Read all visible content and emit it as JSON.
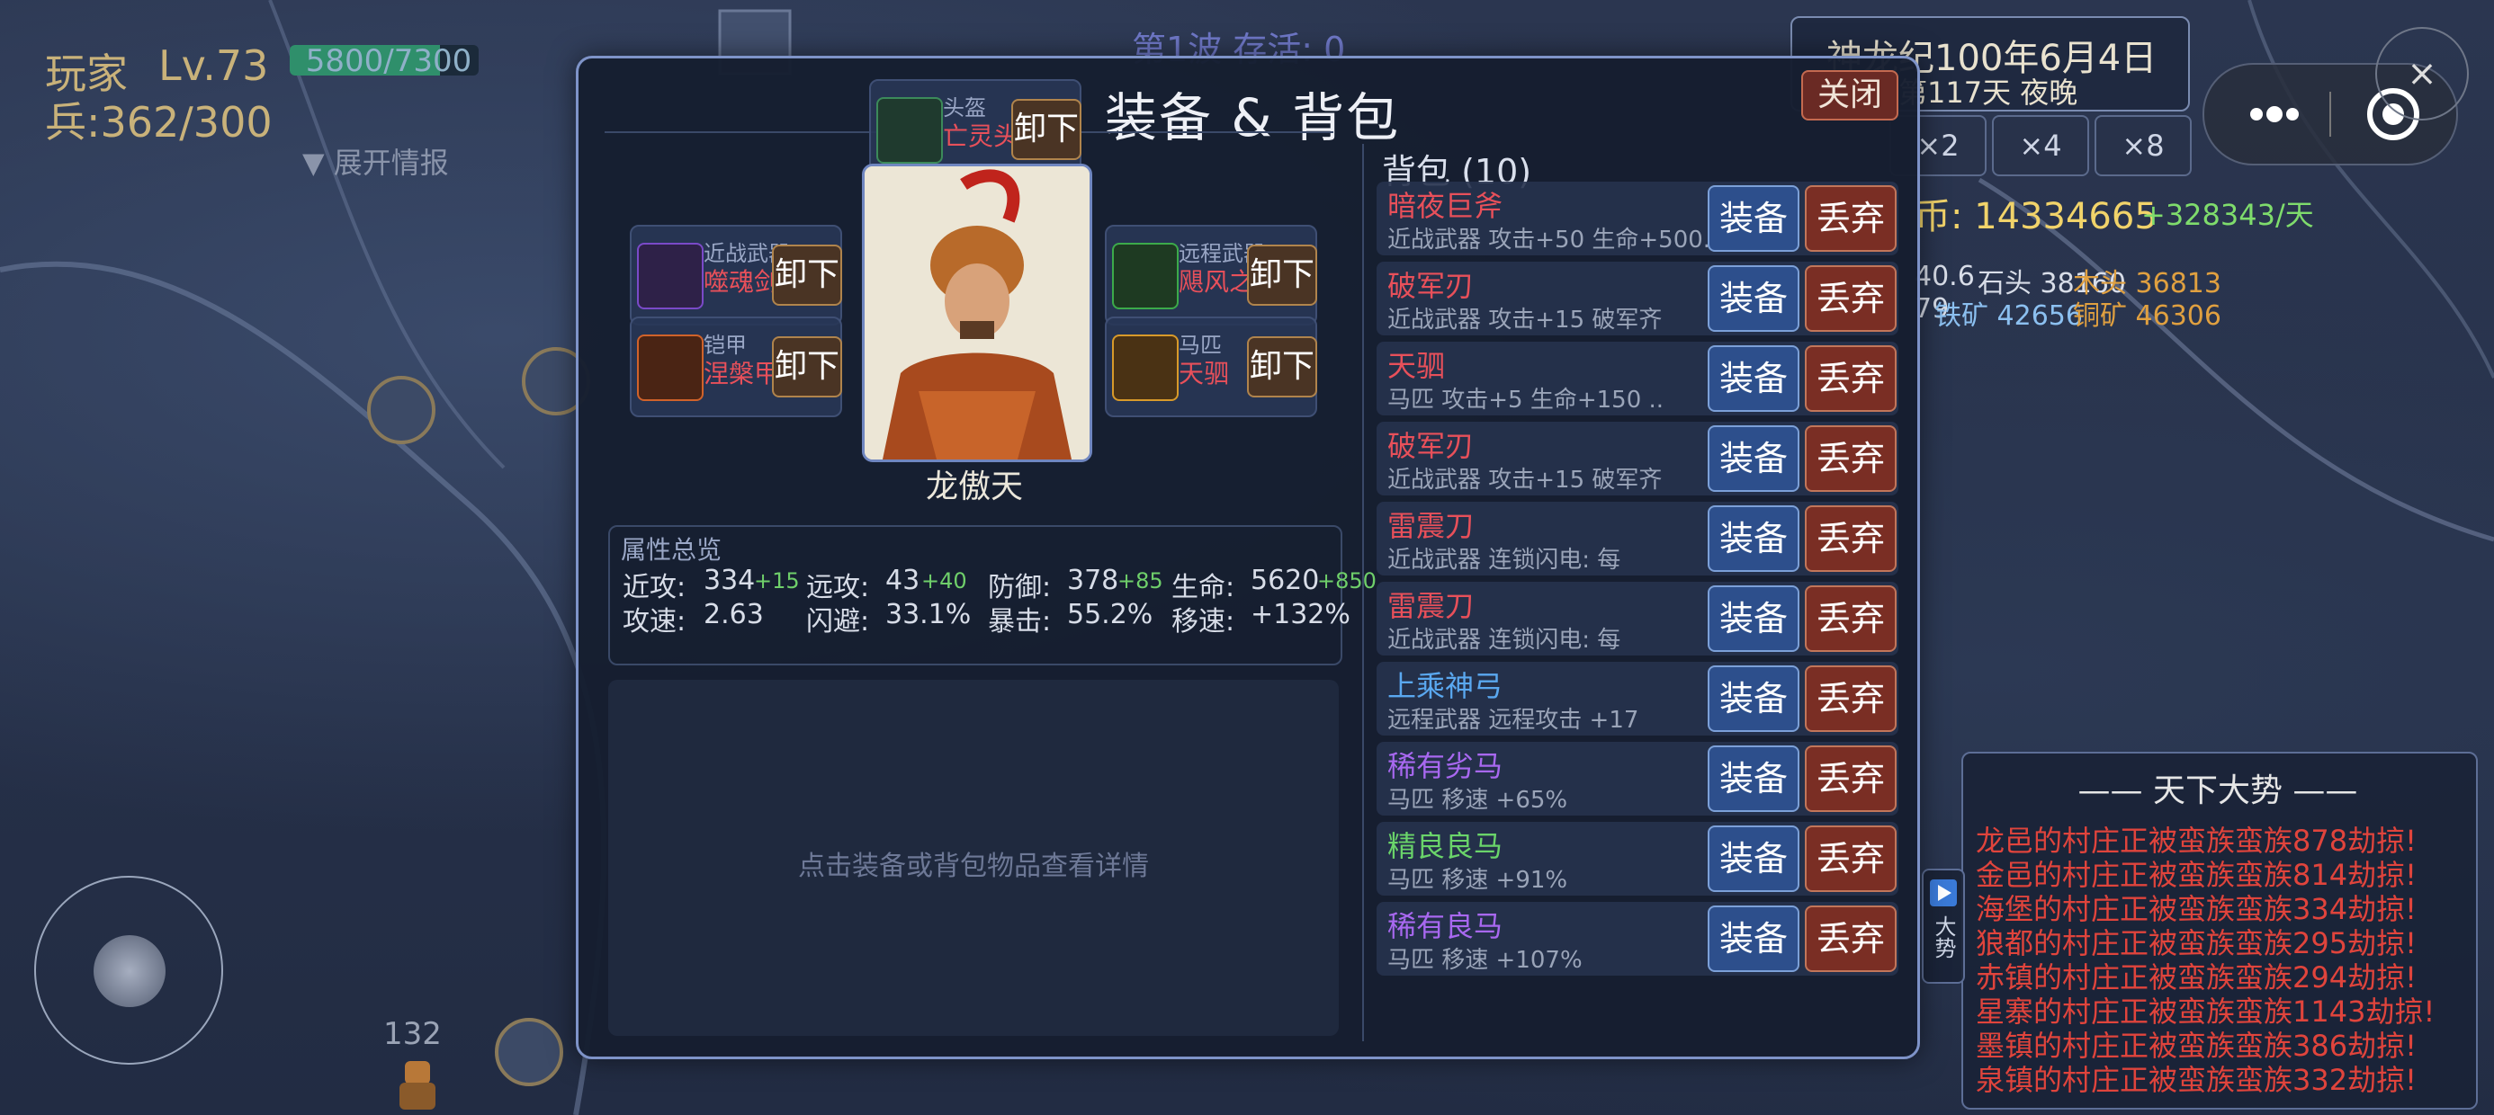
{
  "hud": {
    "player_name": "玩家",
    "level": "Lv.73",
    "xp_text": "5800/7300",
    "xp_fraction": 0.7945,
    "soldiers": "兵:362/300",
    "expand_intel": "▼ 展开情报",
    "wave": "第1波  存活: 0",
    "unit_count": "132"
  },
  "calendar": {
    "line1": "神龙纪100年6月4日",
    "line2": "第117天  夜晚"
  },
  "speed_buttons": [
    "×2",
    "×4",
    "×8"
  ],
  "economy": {
    "coins": "币: 14334665",
    "coins_rate": "+328343/天",
    "resources": [
      {
        "text": "40.6",
        "color": "#d8dde8"
      },
      {
        "text": "石头 38160",
        "color": "#d8dde8"
      },
      {
        "text": "木头 36813",
        "color": "#e0a040"
      },
      {
        "text": "79",
        "color": "#d8dde8"
      },
      {
        "text": "铁矿 42656",
        "color": "#8cc0f0"
      },
      {
        "text": "铜矿 46306",
        "color": "#e0a040"
      }
    ]
  },
  "system": {
    "more_icon": "more-dots-icon",
    "target_icon": "target-icon",
    "close_icon": "close-icon",
    "close_glyph": "×"
  },
  "modal": {
    "title": "装备 & 背包",
    "close_label": "关闭",
    "hero_name": "龙傲天",
    "detail_hint": "点击装备或背包物品查看详情",
    "slots": [
      {
        "type": "头盔",
        "item": "亡灵头",
        "button": "卸下",
        "icon_color": "#3c8a5a"
      },
      {
        "type": "近战武器",
        "item": "噬魂剑",
        "button": "卸下",
        "icon_color": "#7a4ac8"
      },
      {
        "type": "远程武器",
        "item": "飓风之弓",
        "button": "卸下",
        "icon_color": "#3caa4a"
      },
      {
        "type": "铠甲",
        "item": "涅槃甲",
        "button": "卸下",
        "icon_color": "#d0622a"
      },
      {
        "type": "马匹",
        "item": "天驷",
        "button": "卸下",
        "icon_color": "#d89a2a"
      }
    ],
    "attributes": {
      "title": "属性总览",
      "row1": [
        {
          "label": "近攻:",
          "value": "334",
          "bonus": "+15"
        },
        {
          "label": "远攻:",
          "value": "43",
          "bonus": "+40"
        },
        {
          "label": "防御:",
          "value": "378",
          "bonus": "+85"
        },
        {
          "label": "生命:",
          "value": "5620",
          "bonus": "+850"
        }
      ],
      "row2": [
        {
          "label": "攻速:",
          "value": "2.63"
        },
        {
          "label": "闪避:",
          "value": "33.1%"
        },
        {
          "label": "暴击:",
          "value": "55.2%"
        },
        {
          "label": "移速:",
          "value": "+132%"
        }
      ]
    },
    "bag": {
      "title": "背包 (10)",
      "equip_label": "装备",
      "drop_label": "丢弃",
      "items": [
        {
          "name": "暗夜巨斧",
          "desc": "近战武器 攻击+50 生命+500..",
          "color": "#e8505a"
        },
        {
          "name": "破军刃",
          "desc": "近战武器 攻击+15 破军齐",
          "color": "#e8505a"
        },
        {
          "name": "天驷",
          "desc": "马匹 攻击+5 生命+150 ..",
          "color": "#e8505a"
        },
        {
          "name": "破军刃",
          "desc": "近战武器 攻击+15 破军齐",
          "color": "#e8505a"
        },
        {
          "name": "雷震刀",
          "desc": "近战武器 连锁闪电: 每",
          "color": "#e8505a"
        },
        {
          "name": "雷震刀",
          "desc": "近战武器 连锁闪电: 每",
          "color": "#e8505a"
        },
        {
          "name": "上乘神弓",
          "desc": "远程武器 远程攻击 +17",
          "color": "#5aa8f0"
        },
        {
          "name": "稀有劣马",
          "desc": "马匹 移速 +65%",
          "color": "#a868f0"
        },
        {
          "name": "精良良马",
          "desc": "马匹 移速 +91%",
          "color": "#6ad46a"
        },
        {
          "name": "稀有良马",
          "desc": "马匹 移速 +107%",
          "color": "#a868f0"
        }
      ]
    }
  },
  "news": {
    "title": "—— 天下大势 ——",
    "tab_label": "大势",
    "tab_icon": "play-icon",
    "lines": [
      "龙邑的村庄正被蛮族蛮族878劫掠!",
      "金邑的村庄正被蛮族蛮族814劫掠!",
      "海堡的村庄正被蛮族蛮族334劫掠!",
      "狼都的村庄正被蛮族蛮族295劫掠!",
      "赤镇的村庄正被蛮族蛮族294劫掠!",
      "星寨的村庄正被蛮族蛮族1143劫掠!",
      "墨镇的村庄正被蛮族蛮族386劫掠!",
      "泉镇的村庄正被蛮族蛮族332劫掠!"
    ]
  }
}
